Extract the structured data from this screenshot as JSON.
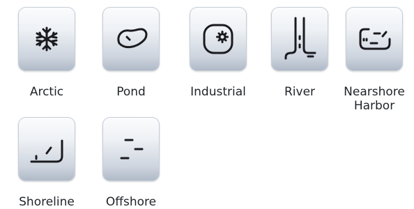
{
  "environments": [
    {
      "id": "arctic",
      "label": "Arctic",
      "icon": "snowflake-icon"
    },
    {
      "id": "pond",
      "label": "Pond",
      "icon": "pond-icon"
    },
    {
      "id": "industrial",
      "label": "Industrial",
      "icon": "industrial-icon"
    },
    {
      "id": "river",
      "label": "River",
      "icon": "river-icon"
    },
    {
      "id": "nearshore-harbor",
      "label": "Nearshore Harbor",
      "icon": "harbor-icon"
    },
    {
      "id": "shoreline",
      "label": "Shoreline",
      "icon": "shoreline-icon"
    },
    {
      "id": "offshore",
      "label": "Offshore",
      "icon": "offshore-icon"
    }
  ]
}
